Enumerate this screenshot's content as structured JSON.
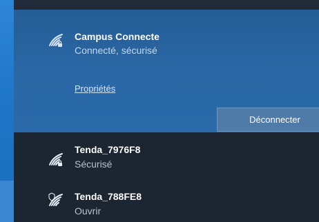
{
  "network_list": {
    "connected": {
      "name": "Campus Connecte",
      "status": "Connecté, sécurisé",
      "properties_link": "Propriétés",
      "action_button": "Déconnecter",
      "icon": "wifi-secure-icon"
    },
    "available": [
      {
        "name": "Tenda_7976F8",
        "status": "Sécurisé",
        "icon": "wifi-secure-icon"
      },
      {
        "name": "Tenda_788FE8",
        "status": "Ouvrir",
        "icon": "wifi-open-shield-icon"
      }
    ]
  },
  "colors": {
    "panel_background": "#1c2532",
    "connected_card": "#2a68a6",
    "button_background": "#4f7ba9",
    "accent_blue": "#2f86d8"
  }
}
